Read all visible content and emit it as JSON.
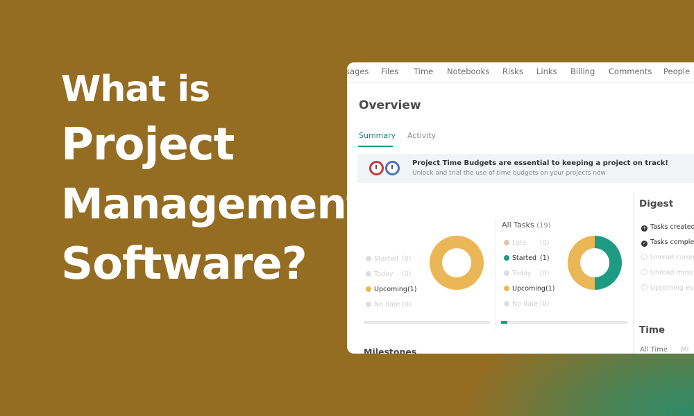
{
  "headline": {
    "line1": "What is",
    "line2": "Project",
    "line3": "Management",
    "line4": "Software?"
  },
  "colors": {
    "background": "#946c22",
    "accent_teal": "#1f9b83",
    "accent_yellow": "#ebb756"
  },
  "nav_tabs": [
    "sages",
    "Files",
    "Time",
    "Notebooks",
    "Risks",
    "Links",
    "Billing",
    "Comments",
    "People"
  ],
  "overview": {
    "title": "Overview",
    "subtabs": [
      "Summary",
      "Activity"
    ]
  },
  "banner": {
    "icons": [
      "timer-icon",
      "gauge-icon"
    ],
    "title": "Project Time Budgets are essential to keeping a project on track!",
    "subtitle": "Unlock and trial the use of time budgets on your projects now"
  },
  "my_tasks": {
    "rows": [
      {
        "label": "Started",
        "count": "(0)"
      },
      {
        "label": "Today",
        "count": "(0)"
      },
      {
        "label": "Upcoming",
        "count": "(1)"
      },
      {
        "label": "No date",
        "count": "(0)"
      }
    ],
    "progress": 0.0
  },
  "all_tasks": {
    "title": "All Tasks",
    "count": "(19)",
    "rows": [
      {
        "label": "Late",
        "count": "(0)"
      },
      {
        "label": "Started",
        "count": "(1)"
      },
      {
        "label": "Today",
        "count": "(0)"
      },
      {
        "label": "Upcoming",
        "count": "(1)"
      },
      {
        "label": "No date",
        "count": "(0)"
      }
    ],
    "progress": 0.05,
    "donut": {
      "started": 1,
      "upcoming": 1
    }
  },
  "digest": {
    "title": "Digest",
    "items": [
      {
        "label": "Tasks created",
        "icon": "plus-circle-icon"
      },
      {
        "label": "Tasks complet",
        "icon": "check-circle-icon"
      },
      {
        "label": "Unread comm",
        "icon": "comment-icon"
      },
      {
        "label": "Unread messa",
        "icon": "mail-icon"
      },
      {
        "label": "Upcoming eve",
        "icon": "calendar-icon"
      }
    ]
  },
  "time": {
    "title": "Time",
    "filters": [
      "All Time",
      "Mi"
    ]
  },
  "milestones": {
    "title": "Milestones"
  }
}
